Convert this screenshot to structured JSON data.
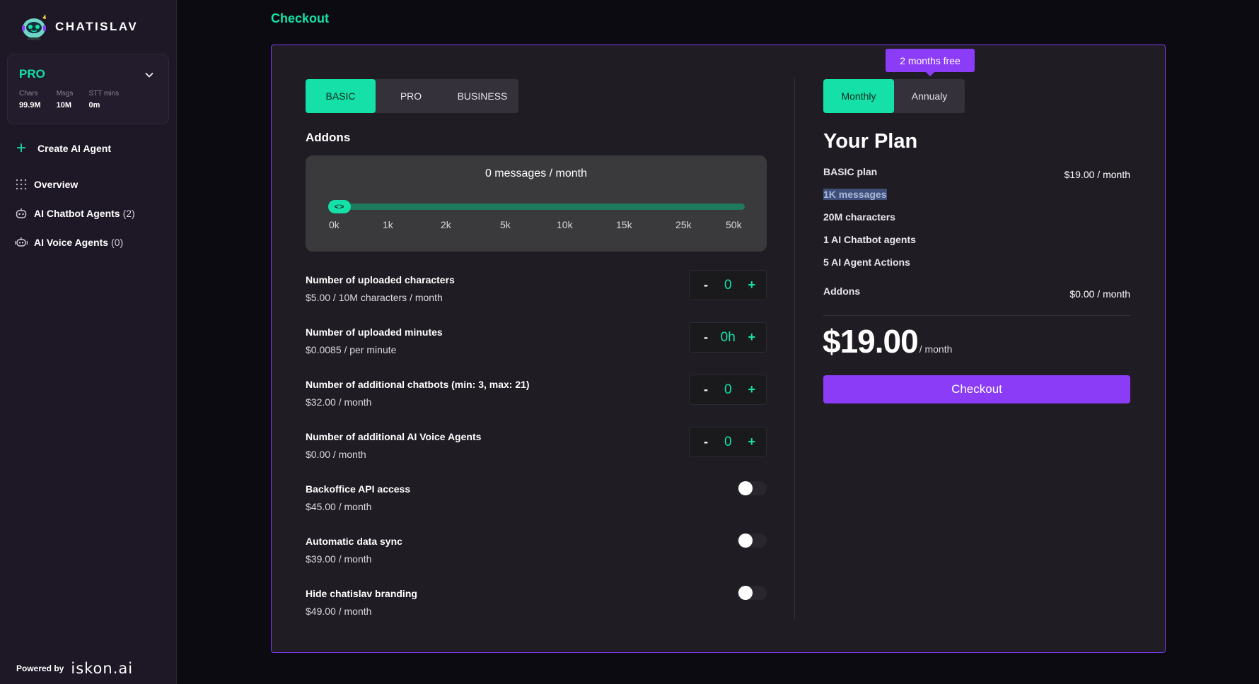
{
  "sidebar": {
    "brand": "CHATISLAV",
    "plan_card": {
      "plan": "PRO",
      "stats": [
        {
          "label": "Chars",
          "value": "99.9M"
        },
        {
          "label": "Msgs",
          "value": "10M"
        },
        {
          "label": "STT mins",
          "value": "0m"
        }
      ]
    },
    "create_agent": "Create AI Agent",
    "nav": [
      {
        "label": "Overview",
        "count": "",
        "icon": "grid-dots-icon"
      },
      {
        "label": "AI Chatbot Agents",
        "count": "(2)",
        "icon": "robot-icon"
      },
      {
        "label": "AI Voice Agents",
        "count": "(0)",
        "icon": "voice-robot-icon"
      }
    ],
    "powered_by": "Powered by",
    "powered_brand": "iskon.ai"
  },
  "main": {
    "title": "Checkout",
    "tiers": [
      {
        "label": "BASIC",
        "active": true
      },
      {
        "label": "PRO",
        "active": false
      },
      {
        "label": "BUSINESS",
        "active": false
      }
    ],
    "addons_title": "Addons",
    "messages_slider": {
      "label": "0 messages / month",
      "ticks": [
        "0k",
        "1k",
        "2k",
        "5k",
        "10k",
        "15k",
        "25k",
        "50k"
      ],
      "selected_index": 0,
      "thumb_glyph": "<>"
    },
    "addons": [
      {
        "name": "Number of uploaded characters",
        "price": "$5.00 / 10M characters / month",
        "control": "stepper",
        "value": "0",
        "minus": "-",
        "plus": "+"
      },
      {
        "name": "Number of uploaded minutes",
        "price": "$0.0085 / per minute",
        "control": "stepper",
        "value": "0h",
        "minus": "-",
        "plus": "+"
      },
      {
        "name": "Number of additional chatbots (min: 3, max: 21)",
        "price": "$32.00 / month",
        "control": "stepper",
        "value": "0",
        "minus": "-",
        "plus": "+"
      },
      {
        "name": "Number of additional AI Voice Agents",
        "price": "$0.00 / month",
        "control": "stepper",
        "value": "0",
        "minus": "-",
        "plus": "+"
      },
      {
        "name": "Backoffice API access",
        "price": "$45.00 / month",
        "control": "toggle",
        "on": false
      },
      {
        "name": "Automatic data sync",
        "price": "$39.00 / month",
        "control": "toggle",
        "on": false
      },
      {
        "name": "Hide chatislav branding",
        "price": "$49.00 / month",
        "control": "toggle",
        "on": false
      }
    ]
  },
  "summary": {
    "promo": "2 months free",
    "billing": [
      {
        "label": "Monthly",
        "active": true
      },
      {
        "label": "Annualy",
        "active": false
      }
    ],
    "title": "Your Plan",
    "plan_name": "BASIC plan",
    "plan_price": "$19.00 / month",
    "features": [
      "1K messages",
      "20M characters",
      "1 AI Chatbot agents",
      "5 AI Agent Actions"
    ],
    "addons_label": "Addons",
    "addons_price": "$0.00 / month",
    "total": "$19.00",
    "total_unit": "/ month",
    "checkout": "Checkout"
  },
  "colors": {
    "accent": "#14e0a7",
    "purple": "#8b3cf7",
    "background": "#0d0b12",
    "panel": "#1f1c23",
    "sidebar": "#1d1726"
  }
}
